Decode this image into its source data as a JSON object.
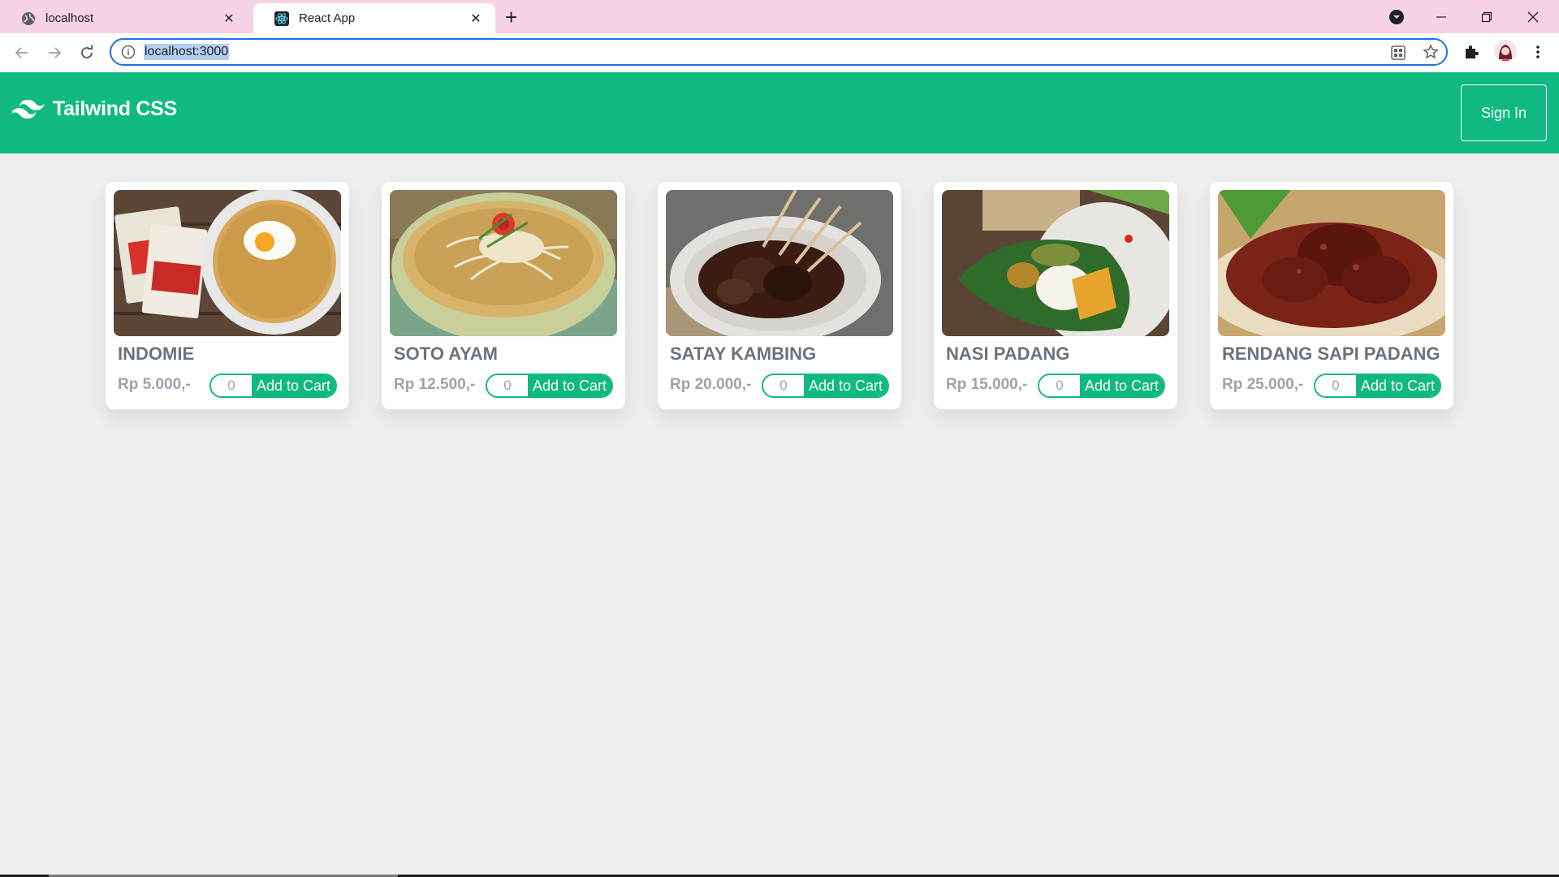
{
  "browser": {
    "tabs": [
      {
        "title": "localhost",
        "icon": "globe-icon",
        "active": false
      },
      {
        "title": "React App",
        "icon": "react-icon",
        "active": true
      }
    ],
    "url": "localhost:3000"
  },
  "header": {
    "brand": "Tailwind CSS",
    "signin_label": "Sign In",
    "background": "#10b981"
  },
  "products": [
    {
      "name": "INDOMIE",
      "price": "Rp 5.000,-",
      "qty": "0",
      "button": "Add to Cart"
    },
    {
      "name": "SOTO AYAM",
      "price": "Rp 12.500,-",
      "qty": "0",
      "button": "Add to Cart"
    },
    {
      "name": "SATAY KAMBING",
      "price": "Rp 20.000,-",
      "qty": "0",
      "button": "Add to Cart"
    },
    {
      "name": "NASI PADANG",
      "price": "Rp 15.000,-",
      "qty": "0",
      "button": "Add to Cart"
    },
    {
      "name": "RENDANG SAPI PADANG",
      "price": "Rp 25.000,-",
      "qty": "0",
      "button": "Add to Cart"
    }
  ]
}
